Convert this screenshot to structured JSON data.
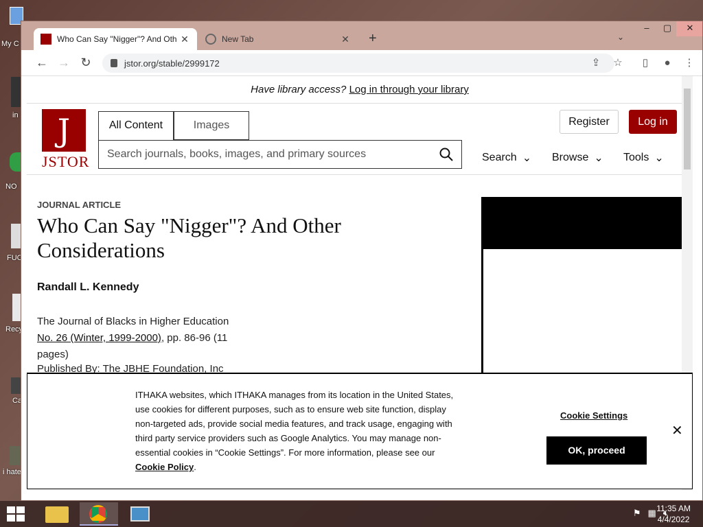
{
  "desktop": {
    "icons": [
      "My C",
      "in",
      "NO",
      "FUC",
      "Recy",
      "Ca",
      "i hate"
    ]
  },
  "browser": {
    "tabs": [
      {
        "title": "Who Can Say \"Nigger\"? And Oth",
        "active": true
      },
      {
        "title": "New Tab",
        "active": false
      }
    ],
    "url": "jstor.org/stable/2999172"
  },
  "page": {
    "banner_question": "Have library access?",
    "banner_link": "Log in through your library",
    "logo_text": "JSTOR",
    "logo_mark": "J",
    "search_tabs": [
      "All Content",
      "Images"
    ],
    "search_placeholder": "Search journals, books, images, and primary sources",
    "register": "Register",
    "login": "Log in",
    "menu": [
      "Search",
      "Browse",
      "Tools"
    ],
    "article": {
      "kind": "JOURNAL ARTICLE",
      "title": "Who Can Say \"Nigger\"? And Other Considerations",
      "author": "Randall L. Kennedy",
      "journal": "The Journal of Blacks in Higher Education",
      "issue_link": "No. 26 (Winter, 1999-2000)",
      "pages": ", pp. 86-96 (11 pages)",
      "publisher": "Published By: The JBHE Foundation, Inc"
    }
  },
  "cookie": {
    "text": "ITHAKA websites, which ITHAKA manages from its location in the United States, use cookies for different purposes, such as to ensure web site function, display non-targeted ads, provide social media features, and track usage, engaging with third party service providers such as Google Analytics. You may manage non-essential cookies in “Cookie Settings”. For more information, please see our",
    "policy_link": "Cookie Policy",
    "settings": "Cookie Settings",
    "ok": "OK, proceed"
  },
  "taskbar": {
    "time": "11:35 AM",
    "date": "4/4/2022"
  }
}
